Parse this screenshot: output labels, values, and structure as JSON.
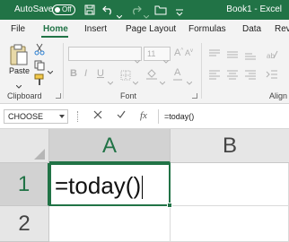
{
  "titlebar": {
    "autosave_label": "AutoSave",
    "autosave_state": "Off",
    "title": "Book1 - Excel"
  },
  "tabs": [
    {
      "label": "File",
      "active": false
    },
    {
      "label": "Home",
      "active": true
    },
    {
      "label": "Insert",
      "active": false
    },
    {
      "label": "Page Layout",
      "active": false
    },
    {
      "label": "Formulas",
      "active": false
    },
    {
      "label": "Data",
      "active": false
    },
    {
      "label": "Rev",
      "active": false
    }
  ],
  "ribbon": {
    "clipboard": {
      "paste_label": "Paste",
      "group_label": "Clipboard"
    },
    "font": {
      "font_size": "11",
      "group_label": "Font"
    },
    "alignment": {
      "group_label": "Align"
    }
  },
  "formula_bar": {
    "name_box": "CHOOSE",
    "cancel_icon": "close-icon",
    "enter_icon": "check-icon",
    "fx_label": "fx",
    "formula": "=today()"
  },
  "grid": {
    "columns": [
      "A",
      "B"
    ],
    "rows": [
      "1",
      "2"
    ],
    "active_cell_content": "=today()"
  },
  "colors": {
    "excel_green": "#217346",
    "header_bg": "#e6e6e6",
    "ribbon_bg": "#f3f3f3"
  }
}
